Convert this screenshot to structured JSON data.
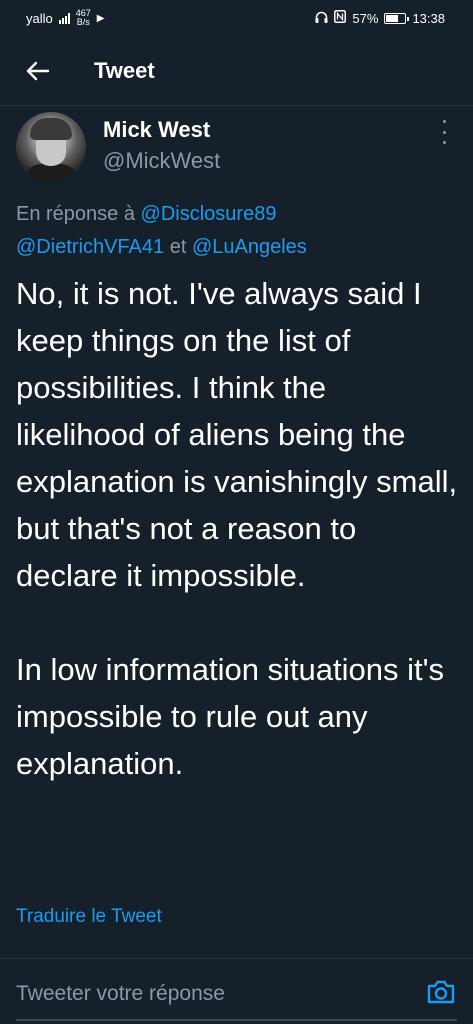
{
  "status_bar": {
    "carrier": "yallo",
    "network_speed": "467",
    "network_unit": "B/s",
    "battery_percent": "57%",
    "battery_level": 0.57,
    "time": "13:38"
  },
  "header": {
    "title": "Tweet"
  },
  "author": {
    "name": "Mick West",
    "handle": "@MickWest"
  },
  "reply_context": {
    "prefix": "En réponse à",
    "mentions": [
      "@Disclosure89",
      "@DietrichVFA41",
      "@LuAngeles"
    ],
    "joiner": "et"
  },
  "tweet": {
    "paragraphs": [
      "No, it is not. I've always said I keep things on the list of possibilities.  I think the likelihood of aliens being the explanation is vanishingly small, but that's not a reason to declare it impossible.",
      "In low information situations it's impossible to rule out any explanation."
    ],
    "translate_label": "Traduire le Tweet"
  },
  "reply_bar": {
    "placeholder": "Tweeter votre réponse"
  },
  "colors": {
    "background": "#15202b",
    "accent": "#1d9bf0",
    "secondary_text": "#8b98a5"
  }
}
